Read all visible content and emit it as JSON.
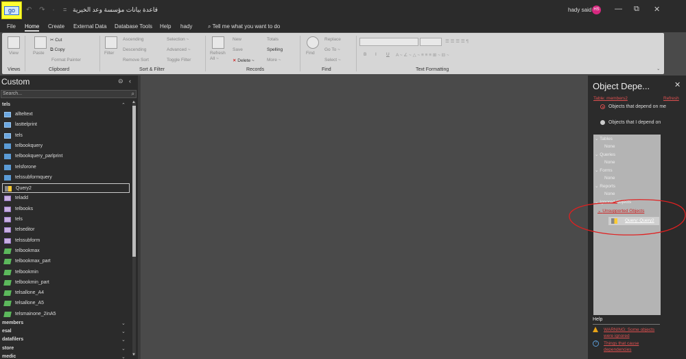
{
  "titlebar": {
    "go_button": "go",
    "quick_access": "↶ ↷ ·",
    "separator": "=",
    "doc_title": "قاعدة بيانات مؤسسة وعد الخيرية",
    "user_name": "hady said",
    "user_initials": "HS",
    "minimize": "—",
    "restore": "⧉",
    "close": "✕"
  },
  "menu": {
    "tabs": [
      "File",
      "Home",
      "Create",
      "External Data",
      "Database Tools",
      "Help",
      "hady"
    ],
    "active": "Home",
    "tell_me": "Tell me what you want to do"
  },
  "ribbon": {
    "groups": [
      "Views",
      "Clipboard",
      "Sort & Filter",
      "Records",
      "Find",
      "Text Formatting"
    ],
    "view": "View",
    "paste": "Paste",
    "cut": "Cut",
    "copy": "Copy",
    "format_painter": "Format Painter",
    "filter": "Filter",
    "ascending": "Ascending",
    "descending": "Descending",
    "remove_sort": "Remove Sort",
    "selection": "Selection ~",
    "advanced": "Advanced ~",
    "toggle_filter": "Toggle Filter",
    "refresh_all": "Refresh All ~",
    "new": "New",
    "save": "Save",
    "delete": "Delete ~",
    "totals": "Totals",
    "spelling": "Spelling",
    "more": "More ~",
    "find": "Find",
    "replace": "Replace",
    "go_to": "Go To ~",
    "select": "Select ~",
    "bold": "B",
    "italic": "I",
    "underline": "U"
  },
  "nav": {
    "title": "Custom",
    "search_placeholder": "Search...",
    "group_open": "tels",
    "items": [
      {
        "label": "allteltext",
        "type": "table"
      },
      {
        "label": "lasttelprint",
        "type": "table"
      },
      {
        "label": "tels",
        "type": "table"
      },
      {
        "label": "telbookquery",
        "type": "query"
      },
      {
        "label": "telbookquery_parlprint",
        "type": "query"
      },
      {
        "label": "telsforone",
        "type": "query"
      },
      {
        "label": "telssubformquery",
        "type": "query"
      },
      {
        "label": "Query2",
        "type": "query2"
      },
      {
        "label": "teladd",
        "type": "form"
      },
      {
        "label": "telbooks",
        "type": "form"
      },
      {
        "label": "tels",
        "type": "form"
      },
      {
        "label": "telseditor",
        "type": "form"
      },
      {
        "label": "telssubform",
        "type": "form"
      },
      {
        "label": "telbookmax",
        "type": "report"
      },
      {
        "label": "telbookmax_part",
        "type": "report"
      },
      {
        "label": "telbookmin",
        "type": "report"
      },
      {
        "label": "telbookmin_part",
        "type": "report"
      },
      {
        "label": "telsallone_A4",
        "type": "report"
      },
      {
        "label": "telsallone_A5",
        "type": "report"
      },
      {
        "label": "telsmainone_2inA5",
        "type": "report"
      }
    ],
    "collapsed_groups": [
      "members",
      "esal",
      "datafilers",
      "store",
      "medic"
    ]
  },
  "dependencies": {
    "title": "Object Depe...",
    "close": "✕",
    "table_link": "Table: members2",
    "refresh": "Refresh",
    "radio_depend_on_me": "Objects that depend on me",
    "radio_i_depend_on": "Objects that I depend on",
    "tree": {
      "tables": "Tables",
      "queries": "Queries",
      "forms": "Forms",
      "reports": "Reports",
      "none": "None",
      "ignored": "Ignored Objects",
      "unsupported": "Unsupported Objects",
      "query_item": "Query: Query2"
    },
    "help": {
      "label": "Help",
      "warning": "WARNING: Some objects were ignored",
      "things": "Things that cause dependencies"
    }
  },
  "colors": {
    "annotation": "#e02020",
    "accent_red": "#e05050",
    "go_highlight": "#ffff33"
  }
}
